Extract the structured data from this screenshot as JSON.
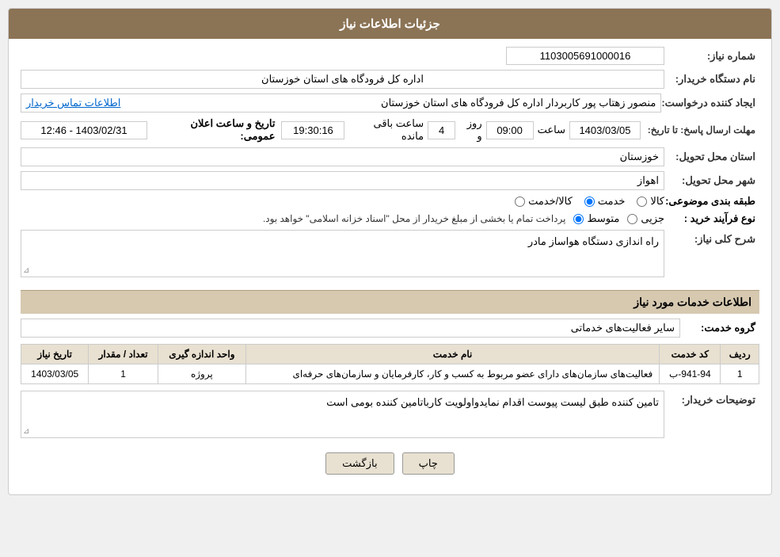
{
  "header": {
    "title": "جزئیات اطلاعات نیاز"
  },
  "fields": {
    "shomara_niaz_label": "شماره نیاز:",
    "shomara_niaz_value": "1103005691000016",
    "nam_dastgah_label": "نام دستگاه خریدار:",
    "nam_dastgah_value": "اداره کل فرودگاه های استان خوزستان",
    "ijad_konande_label": "ایجاد کننده درخواست:",
    "ijad_konande_value": "منصور زهتاب پور کاربردار اداره کل فرودگاه های استان خوزستان",
    "ijad_konande_link": "اطلاعات تماس خریدار",
    "mohlat_label": "مهلت ارسال پاسخ: تا تاریخ:",
    "mohlat_date": "1403/03/05",
    "mohlat_time_label": "ساعت",
    "mohlat_time": "09:00",
    "mohlat_day_label": "روز و",
    "mohlat_day": "4",
    "mohlat_remaining_label": "ساعت باقی مانده",
    "mohlat_remaining": "19:30:16",
    "announce_label": "تاریخ و ساعت اعلان عمومی:",
    "announce_value": "1403/02/31 - 12:46",
    "ostan_label": "استان محل تحویل:",
    "ostan_value": "خوزستان",
    "shahr_label": "شهر محل تحویل:",
    "shahr_value": "اهواز",
    "tabaqe_label": "طبقه بندی موضوعی:",
    "tabaqe_options": [
      "کالا",
      "خدمت",
      "کالا/خدمت"
    ],
    "tabaqe_selected": "خدمت",
    "novea_label": "نوع فرآیند خرید :",
    "novea_options": [
      "جزیی",
      "متوسط"
    ],
    "novea_selected": "متوسط",
    "novea_note": "پرداخت تمام یا بخشی از مبلغ خریدار از محل \"اسناد خزانه اسلامی\" خواهد بود.",
    "sharh_label": "شرح کلی نیاز:",
    "sharh_value": "راه اندازی دستگاه هواساز مادر",
    "service_section": "اطلاعات خدمات مورد نیاز",
    "group_label": "گروه خدمت:",
    "group_value": "سایر فعالیت‌های خدماتی",
    "table": {
      "headers": [
        "ردیف",
        "کد خدمت",
        "نام خدمت",
        "واحد اندازه گیری",
        "تعداد / مقدار",
        "تاریخ نیاز"
      ],
      "rows": [
        {
          "radif": "1",
          "code": "941-94-ب",
          "name": "فعالیت‌های سازمان‌های دارای عضو مربوط به کسب و کار، کارفرمایان و سازمان‌های حرفه‌ای",
          "unit": "پروژه",
          "count": "1",
          "date": "1403/03/05"
        }
      ]
    },
    "buyer_notes_label": "توضیحات خریدار:",
    "buyer_notes_value": "تامین کننده طبق لیست پیوست اقدام نمایدواولویت کارباتامین کننده بومی است"
  },
  "buttons": {
    "print": "چاپ",
    "back": "بازگشت"
  }
}
